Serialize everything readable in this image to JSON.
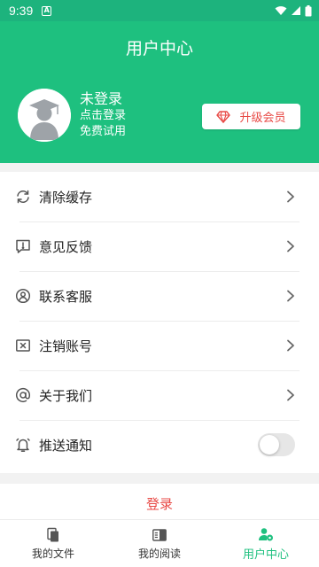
{
  "status_bar": {
    "time": "9:39",
    "indicator_icon": "a-notification-icon"
  },
  "header": {
    "title": "用户中心"
  },
  "profile": {
    "name": "未登录",
    "login_prompt": "点击登录",
    "trial_text": "免费试用",
    "vip_button_label": "升级会员"
  },
  "settings": {
    "items": [
      {
        "label": "清除缓存",
        "icon": "refresh-icon"
      },
      {
        "label": "意见反馈",
        "icon": "feedback-icon"
      },
      {
        "label": "联系客服",
        "icon": "customer-service-icon"
      },
      {
        "label": "注销账号",
        "icon": "cancel-account-icon"
      },
      {
        "label": "关于我们",
        "icon": "at-icon"
      },
      {
        "label": "推送通知",
        "icon": "bell-icon",
        "toggle": false
      }
    ]
  },
  "login_button_label": "登录",
  "bottom_nav": {
    "items": [
      {
        "label": "我的文件",
        "icon": "file-icon",
        "active": false
      },
      {
        "label": "我的阅读",
        "icon": "book-icon",
        "active": false
      },
      {
        "label": "用户中心",
        "icon": "user-settings-icon",
        "active": true
      }
    ]
  },
  "colors": {
    "primary": "#1ec07f",
    "accent": "#e84a46"
  }
}
